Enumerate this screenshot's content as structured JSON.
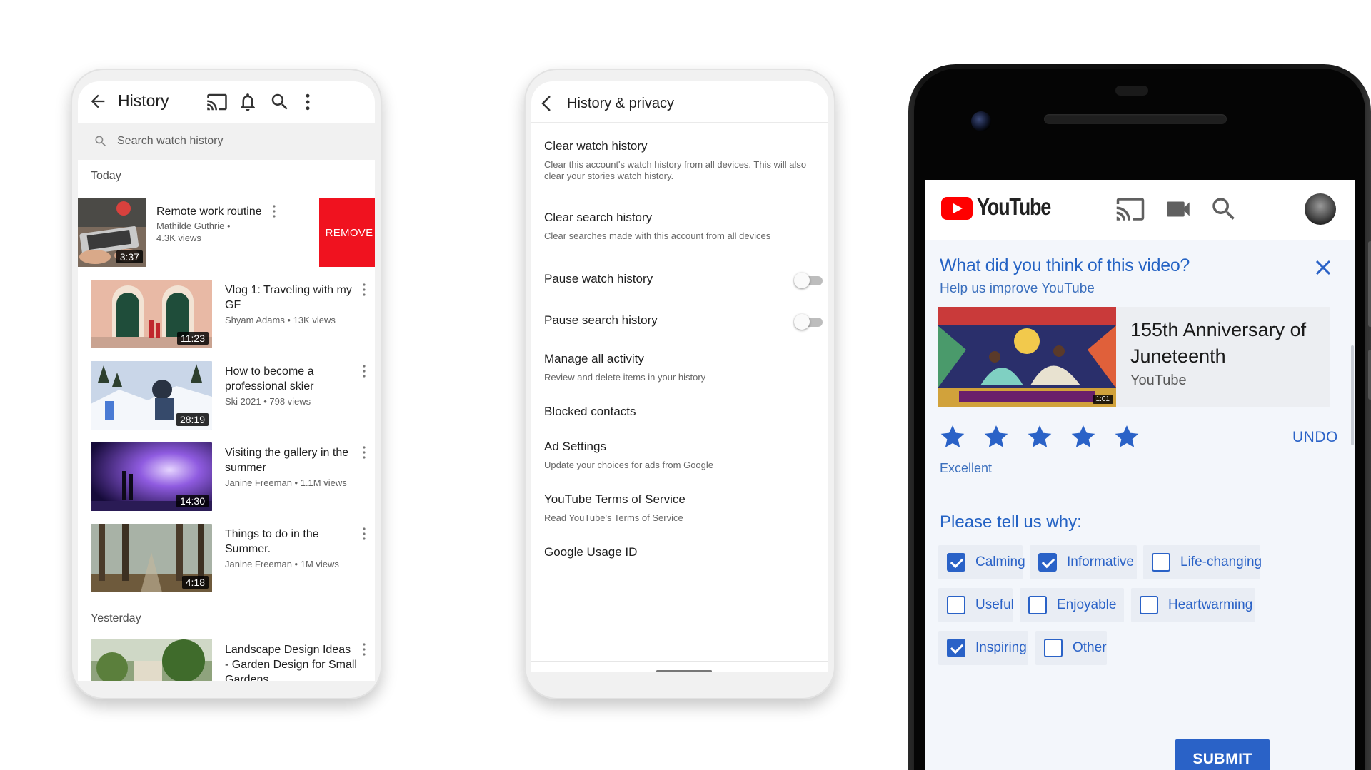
{
  "colors": {
    "brand_red": "#f0121f",
    "accent_blue": "#2a62c7",
    "text_dark": "#202020",
    "text_muted": "#606060"
  },
  "history": {
    "title": "History",
    "icons": [
      "back-arrow-icon",
      "cast-icon",
      "bell-icon",
      "search-icon",
      "more-vert-icon"
    ],
    "search_placeholder": "Search watch history",
    "today_label": "Today",
    "yesterday_label": "Yesterday",
    "remove_label": "REMOVE",
    "swiped": {
      "title": "Remote work routine",
      "meta": "Mathilde Guthrie • 4.3K views",
      "duration": "3:37"
    },
    "videos": [
      {
        "title": "Vlog 1: Traveling with my GF",
        "meta": "Shyam Adams • 13K views",
        "duration": "11:23"
      },
      {
        "title": "How to become a professional skier",
        "meta": "Ski 2021 • 798 views",
        "duration": "28:19"
      },
      {
        "title": "Visiting the gallery in the summer",
        "meta": "Janine Freeman • 1.1M views",
        "duration": "14:30"
      },
      {
        "title": "Things to do in the Summer.",
        "meta": "Janine Freeman • 1M views",
        "duration": "4:18"
      }
    ],
    "yesterday_videos": [
      {
        "title": "Landscape Design Ideas - Garden Design for Small Gardens"
      }
    ]
  },
  "privacy": {
    "title": "History & privacy",
    "items": [
      {
        "title": "Clear watch history",
        "desc": "Clear this account's watch history from all devices. This will also clear your stories watch history."
      },
      {
        "title": "Clear search history",
        "desc": "Clear searches made with this account from all devices"
      },
      {
        "title": "Pause watch history",
        "toggle": false
      },
      {
        "title": "Pause search history",
        "toggle": false
      },
      {
        "title": "Manage all activity",
        "desc": "Review and delete items in your history"
      },
      {
        "title": "Blocked contacts"
      },
      {
        "title": "Ad Settings",
        "desc": "Update your choices for ads from Google"
      },
      {
        "title": "YouTube Terms of Service",
        "desc": "Read YouTube's Terms of Service"
      },
      {
        "title": "Google Usage ID"
      }
    ]
  },
  "feedback": {
    "app_name": "YouTube",
    "question": "What did you think of this video?",
    "subtitle": "Help us improve YouTube",
    "video_title": "155th Anniversary of Juneteenth",
    "video_channel": "YouTube",
    "thumb_duration": "1:01",
    "rating": 5,
    "rating_max": 5,
    "rating_label": "Excellent",
    "undo_label": "UNDO",
    "reasons_title": "Please tell us why:",
    "reasons": [
      {
        "label": "Calming",
        "checked": true
      },
      {
        "label": "Informative",
        "checked": true
      },
      {
        "label": "Life-changing",
        "checked": false
      },
      {
        "label": "Useful",
        "checked": false
      },
      {
        "label": "Enjoyable",
        "checked": false
      },
      {
        "label": "Heartwarming",
        "checked": false
      },
      {
        "label": "Inspiring",
        "checked": true
      },
      {
        "label": "Other",
        "checked": false
      }
    ],
    "submit_label": "SUBMIT"
  }
}
